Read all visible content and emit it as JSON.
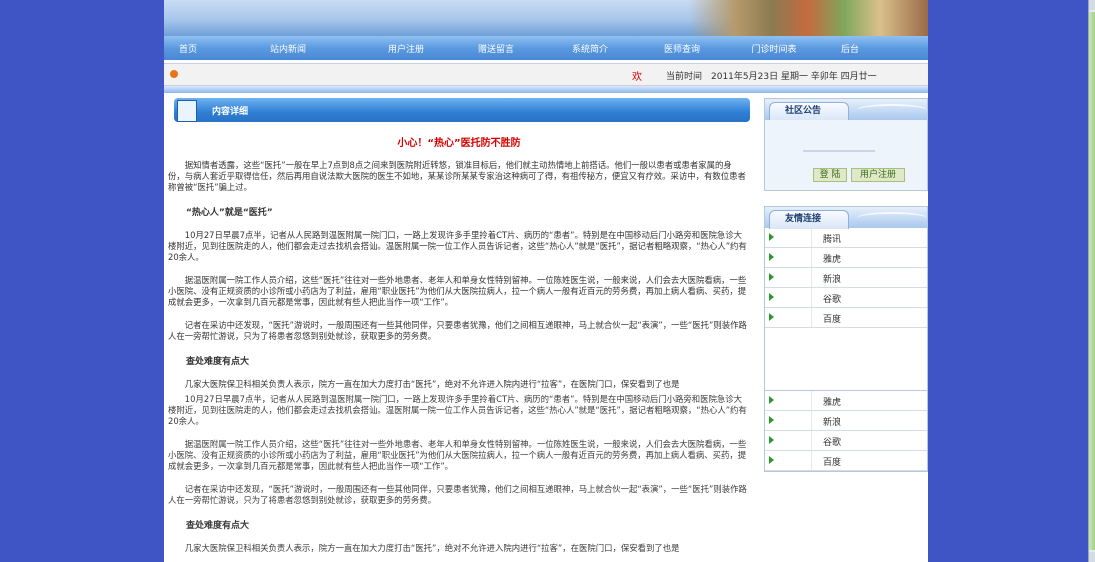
{
  "nav": {
    "items": [
      "首页",
      "站内新闻",
      "用户注册",
      "赠送留言",
      "系统简介",
      "医师查询",
      "门诊时间表",
      "后台"
    ]
  },
  "infobar": {
    "welcome": "欢",
    "date_text": "当前时间　2011年5月23日 星期一 辛卯年 四月廿一"
  },
  "content": {
    "header_title": "内容详细",
    "article_title": "小心！“热心”医托防不胜防",
    "paragraphs": [
      {
        "type": "p",
        "text": "据知情者透露，这些“医托”一般在早上7点到8点之间来到医院附近转悠，锁准目标后，他们就主动热情地上前搭话。他们一般以患者或患者家属的身份，与病人套近乎取得信任，然后再用自说法欺大医院的医生不如地，某某诊所某某专家治这种病可了得，有祖传秘方，便宜又有疗效。采访中，有数位患者称曾被“医托”骗上过。"
      },
      {
        "type": "h",
        "text": "“热心人”就是“医托”"
      },
      {
        "type": "p",
        "text": "10月27日早晨7点半，记者从人民路到温医附属一院门口，一路上发现许多手里拎着CT片、病历的“患者”。特别是在中国移动后门小路旁和医院急诊大楼附近，见到往医院走的人，他们都会走过去找机会搭讪。温医附属一院一位工作人员告诉记者，这些“热心人”就是“医托”，据记者粗略观察，“热心人”约有20余人。"
      },
      {
        "type": "p",
        "text": "据温医附属一院工作人员介绍，这些“医托”往往对一些外地患者、老年人和单身女性特别留神。一位陈姓医生说，一般来说，人们会去大医院看病，一些小医院、没有正规资质的小诊所或小药店为了利益，雇用“职业医托”为他们从大医院拉病人，拉一个病人一般有近百元的劳务费，再加上病人看病、买药，提成就会更多，一次拿到几百元都是常事，因此就有些人把此当作一项“工作”。"
      },
      {
        "type": "p",
        "text": "记者在采访中还发现，“医托”游说时，一般周围还有一些其他同伴，只要患者犹豫，他们之间相互递眼神，马上就合伙一起“表演”，一些“医托”则装作路人在一旁帮忙游说，只为了将患者忽悠到别处就诊，获取更多的劳务费。"
      },
      {
        "type": "h",
        "text": "查处难度有点大"
      },
      {
        "type": "p",
        "text": "几家大医院保卫科相关负责人表示，院方一直在加大力度打击“医托”，绝对不允许进入院内进行“拉客”，在医院门口，保安看到了也是"
      }
    ],
    "duplicate_paragraphs": [
      {
        "type": "p",
        "text": "10月27日早晨7点半，记者从人民路到温医附属一院门口，一路上发现许多手里拎着CT片、病历的“患者”。特别是在中国移动后门小路旁和医院急诊大楼附近，见到往医院走的人，他们都会走过去找机会搭讪。温医附属一院一位工作人员告诉记者，这些“热心人”就是“医托”，据记者粗略观察，“热心人”约有20余人。"
      },
      {
        "type": "p",
        "text": "据温医附属一院工作人员介绍，这些“医托”往往对一些外地患者、老年人和单身女性特别留神。一位陈姓医生说，一般来说，人们会去大医院看病，一些小医院、没有正规资质的小诊所或小药店为了利益，雇用“职业医托”为他们从大医院拉病人，拉一个病人一般有近百元的劳务费，再加上病人看病、买药，提成就会更多，一次拿到几百元都是常事，因此就有些人把此当作一项“工作”。"
      },
      {
        "type": "p",
        "text": "记者在采访中还发现，“医托”游说时，一般周围还有一些其他同伴，只要患者犹豫，他们之间相互递眼神，马上就合伙一起“表演”，一些“医托”则装作路人在一旁帮忙游说，只为了将患者忽悠到别处就诊，获取更多的劳务费。"
      },
      {
        "type": "h",
        "text": "查处难度有点大"
      },
      {
        "type": "p",
        "text": "几家大医院保卫科相关负责人表示，院方一直在加大力度打击“医托”，绝对不允许进入院内进行“拉客”，在医院门口，保安看到了也是"
      }
    ]
  },
  "sidebar": {
    "notice_title": "社区公告",
    "login_label": "登 陆",
    "register_label": "用户注册",
    "links_title": "友情连接",
    "links": [
      "腾讯",
      "雅虎",
      "新浪",
      "谷歌",
      "百度"
    ],
    "links_repeat": [
      "雅虎",
      "新浪",
      "谷歌",
      "百度"
    ]
  }
}
